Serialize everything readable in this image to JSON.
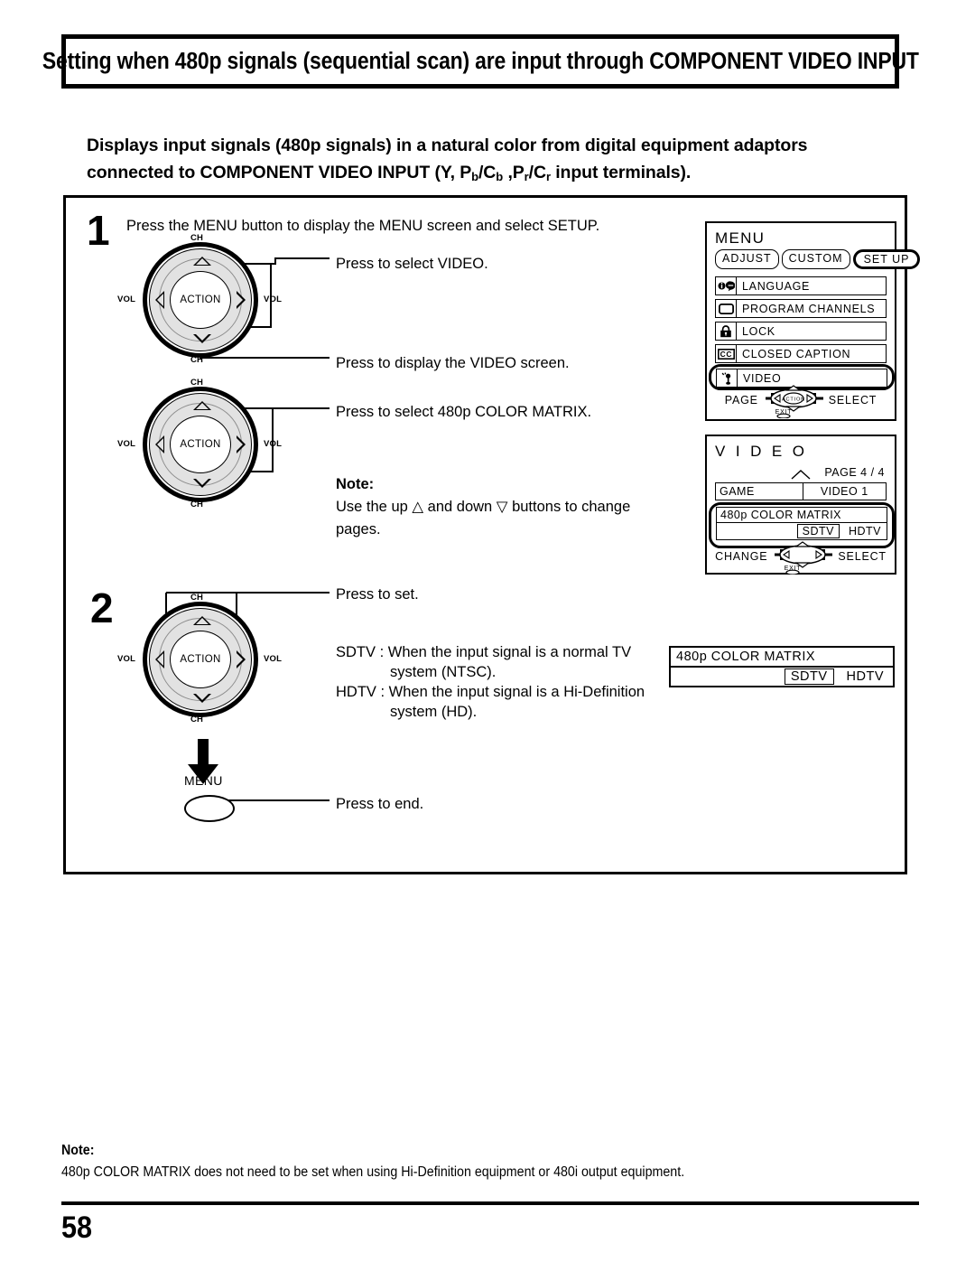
{
  "title": "Setting when 480p signals (sequential scan) are input through COMPONENT VIDEO INPUT",
  "subheading": {
    "line1": "Displays input signals (480p signals) in a natural color from digital equipment adaptors",
    "line2_a": "connected to COMPONENT VIDEO INPUT (Y, P",
    "sub_b1": "b",
    "line2_b": "/C",
    "sub_b2": "b",
    "line2_c": " ,P",
    "sub_r1": "r",
    "line2_d": "/C",
    "sub_r2": "r",
    "line2_e": " input terminals)."
  },
  "steps": {
    "one": "1",
    "two": "2",
    "step1_intro": "Press the MENU button to display the MENU screen and select SETUP.",
    "callout_select_video": "Press to select VIDEO.",
    "callout_display_video": "Press to display the VIDEO screen.",
    "callout_select_matrix": "Press to select 480p COLOR MATRIX.",
    "callout_press_to_set": "Press to set.",
    "callout_press_to_end": "Press to end."
  },
  "note_inline": {
    "label": "Note:",
    "text": "Use the up △ and down ▽ buttons to change pages."
  },
  "definitions": {
    "sdtv": "SDTV : When the input signal is a normal TV",
    "sdtv_cont": "system (NTSC).",
    "hdtv": "HDTV : When the input signal is a Hi-Definition",
    "hdtv_cont": "system (HD)."
  },
  "remote": {
    "action_label": "ACTION",
    "ch_label": "CH",
    "vol_label": "VOL",
    "menu_button_label": "MENU"
  },
  "menu_osd": {
    "title": "MENU",
    "tabs": [
      {
        "label": "ADJUST",
        "selected": false
      },
      {
        "label": "CUSTOM",
        "selected": false
      },
      {
        "label": "SET UP",
        "selected": true
      }
    ],
    "items": [
      {
        "label": "LANGUAGE",
        "icon": "language-icon",
        "highlighted": false
      },
      {
        "label": "PROGRAM CHANNELS",
        "icon": "tv-screen-icon",
        "highlighted": false
      },
      {
        "label": "LOCK",
        "icon": "padlock-icon",
        "highlighted": false
      },
      {
        "label": "CLOSED CAPTION",
        "icon": "cc-icon",
        "highlighted": false
      },
      {
        "label": "VIDEO",
        "icon": "video-plug-icon",
        "highlighted": true
      }
    ],
    "nav": {
      "left_label": "PAGE",
      "right_label": "SELECT",
      "center_label": "ACTION",
      "exit_label": "EXIT"
    }
  },
  "video_osd": {
    "title": "V I D E O",
    "page_indicator": "PAGE 4 / 4",
    "row_left": "GAME",
    "row_right": "VIDEO 1",
    "matrix_label": "480p  COLOR MATRIX",
    "option_sdtv": "SDTV",
    "option_hdtv": "HDTV",
    "selected_option": "SDTV",
    "nav": {
      "left_label": "CHANGE",
      "right_label": "SELECT",
      "center_label": "ACTION",
      "exit_label": "EXIT"
    }
  },
  "matrix_popup": {
    "label": "480p  COLOR MATRIX",
    "option_sdtv": "SDTV",
    "option_hdtv": "HDTV",
    "selected_option": "SDTV"
  },
  "footer": {
    "note_label": "Note:",
    "note_text": "480p COLOR MATRIX does not need to be set when using Hi-Definition equipment or 480i output equipment.",
    "page_number": "58"
  },
  "colors": {
    "ink": "#000000",
    "paper": "#ffffff",
    "dial_face": "#e2e2e2"
  }
}
